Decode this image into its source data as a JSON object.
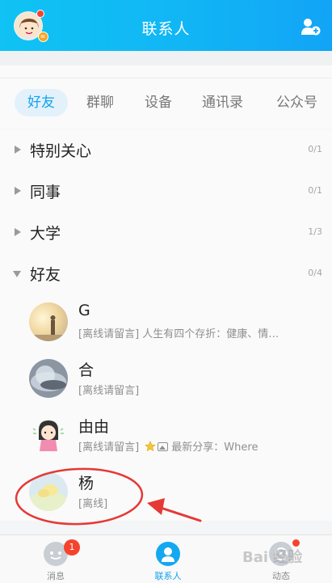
{
  "header": {
    "title": "联系人",
    "avatar_icon": "user-avatar-cartoon",
    "add_icon": "add-contact-icon",
    "accent": "#12b0f5"
  },
  "tabs": [
    {
      "label": "好友",
      "active": true
    },
    {
      "label": "群聊",
      "active": false
    },
    {
      "label": "设备",
      "active": false
    },
    {
      "label": "通讯录",
      "active": false
    },
    {
      "label": "公众号",
      "active": false
    }
  ],
  "groups": [
    {
      "name": "特别关心",
      "count": "0/1",
      "expanded": false
    },
    {
      "name": "同事",
      "count": "0/1",
      "expanded": false
    },
    {
      "name": "大学",
      "count": "1/3",
      "expanded": false
    },
    {
      "name": "好友",
      "count": "0/4",
      "expanded": true
    }
  ],
  "friends": [
    {
      "name": "G",
      "status": "[离线请留言]",
      "message": "人生有四个存折：健康、情…"
    },
    {
      "name": "合",
      "status": "[离线请留言]",
      "message": ""
    },
    {
      "name": "由由",
      "status": "[离线请留言]",
      "message": "最新分享：Where"
    },
    {
      "name": "杨",
      "status": "[离线]",
      "message": ""
    }
  ],
  "bottom_nav": [
    {
      "label": "消息",
      "badge": "1"
    },
    {
      "label": "联系人",
      "active": true
    },
    {
      "label": "动态",
      "dot": true
    }
  ],
  "watermark": "Bai 经验",
  "colors": {
    "annotation": "#e53935",
    "badge": "#f5432e"
  }
}
